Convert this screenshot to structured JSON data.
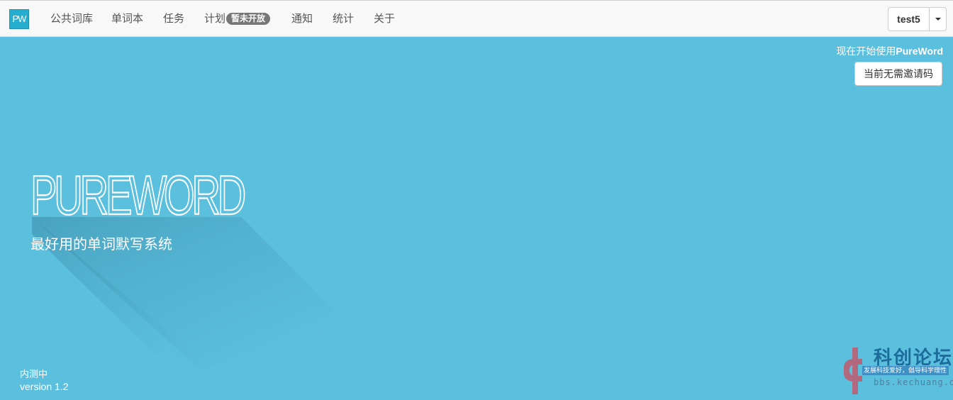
{
  "navbar": {
    "logo_text": "PW",
    "items": [
      {
        "label": "公共词库"
      },
      {
        "label": "单词本"
      },
      {
        "label": "任务"
      },
      {
        "label": "计划",
        "badge": "暂未开放"
      },
      {
        "label": "通知"
      },
      {
        "label": "统计"
      },
      {
        "label": "关于"
      }
    ],
    "user": {
      "name": "test5"
    }
  },
  "hero": {
    "start_prefix": "现在开始使用",
    "start_brand": "PureWord",
    "invite_button": "当前无需邀请码",
    "brand_title": "PUREWORD",
    "tagline": "最好用的单词默写系统",
    "status": "内测中",
    "version": "version 1.2"
  },
  "watermark": {
    "title": "科创论坛",
    "subtitle": "发展科技爱好，倡导科学理性",
    "url": "bbs.kechuang.org"
  },
  "colors": {
    "background": "#5bc0de",
    "navbar": "#f8f8f8",
    "logo": "#25aed0",
    "badge": "#777777"
  }
}
